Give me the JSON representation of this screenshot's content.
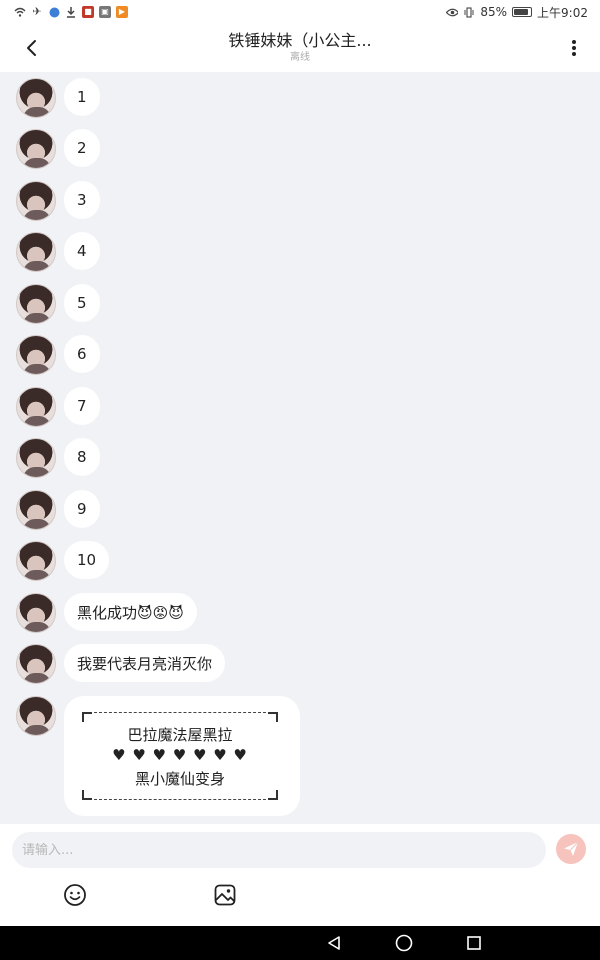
{
  "status_bar": {
    "left_icons": [
      "wifi-icon",
      "airplane-icon",
      "app-icon",
      "download-icon",
      "app-icon",
      "app-icon",
      "app-icon"
    ],
    "battery": "85%",
    "time": "上午9:02",
    "colors": {
      "app_blue": "#3d7fd6",
      "app_red": "#c0392b",
      "app_orange": "#f08a24"
    }
  },
  "header": {
    "back_icon": "chevron-left-icon",
    "title": "铁锤妹妹（小公主...",
    "subtitle": "离线",
    "more_icon": "more-vertical-icon"
  },
  "messages": [
    {
      "text": "1"
    },
    {
      "text": "2"
    },
    {
      "text": "3"
    },
    {
      "text": "4"
    },
    {
      "text": "5"
    },
    {
      "text": "6"
    },
    {
      "text": "7"
    },
    {
      "text": "8"
    },
    {
      "text": "9"
    },
    {
      "text": "10"
    },
    {
      "text": "黑化成功😈😡😈"
    },
    {
      "text": "我要代表月亮消灭你"
    }
  ],
  "card_message": {
    "line1": "巴拉魔法屋黑拉",
    "line2": "♥ ♥ ♥ ♥ ♥ ♥ ♥",
    "line3": "黑小魔仙变身"
  },
  "input": {
    "placeholder": "请输入...",
    "value": "",
    "send_icon": "send-icon",
    "tools": [
      "emoji-icon",
      "image-icon"
    ]
  },
  "colors": {
    "background": "#f1f2f6",
    "bubble": "#ffffff",
    "send_button": "#f6c3bd"
  }
}
